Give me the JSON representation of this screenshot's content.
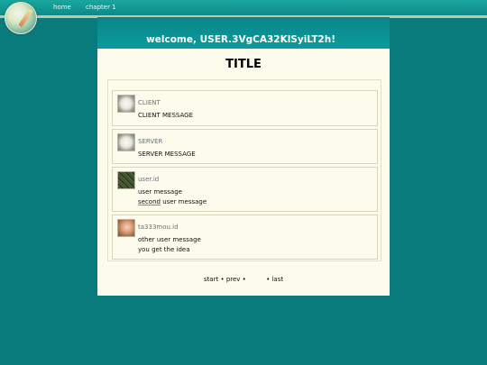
{
  "nav": {
    "home": "home",
    "chapter": "chapter 1"
  },
  "header": {
    "welcome": "welcome, USER.3VgCA32KlSyiLT2h!"
  },
  "page": {
    "title": "TITLE"
  },
  "messages": [
    {
      "sender": "CLIENT",
      "lines": [
        "CLIENT MESSAGE"
      ],
      "avatar": "bot-avatar"
    },
    {
      "sender": "SERVER",
      "lines": [
        "SERVER MESSAGE"
      ],
      "avatar": "bot-avatar"
    },
    {
      "sender": "user.id",
      "lines": [
        "user message"
      ],
      "second_word": "second",
      "second_rest": " user message",
      "avatar": "photo-avatar"
    },
    {
      "sender": "ta333mou.id",
      "lines": [
        "other user message",
        "you get the idea"
      ],
      "avatar": "face-avatar"
    }
  ],
  "pager": {
    "start": "start",
    "prev": "prev",
    "last": "last",
    "bullet": "•"
  },
  "colors": {
    "background": "#0a7b7d",
    "panel": "#fdfcec",
    "header": "#08868a"
  }
}
